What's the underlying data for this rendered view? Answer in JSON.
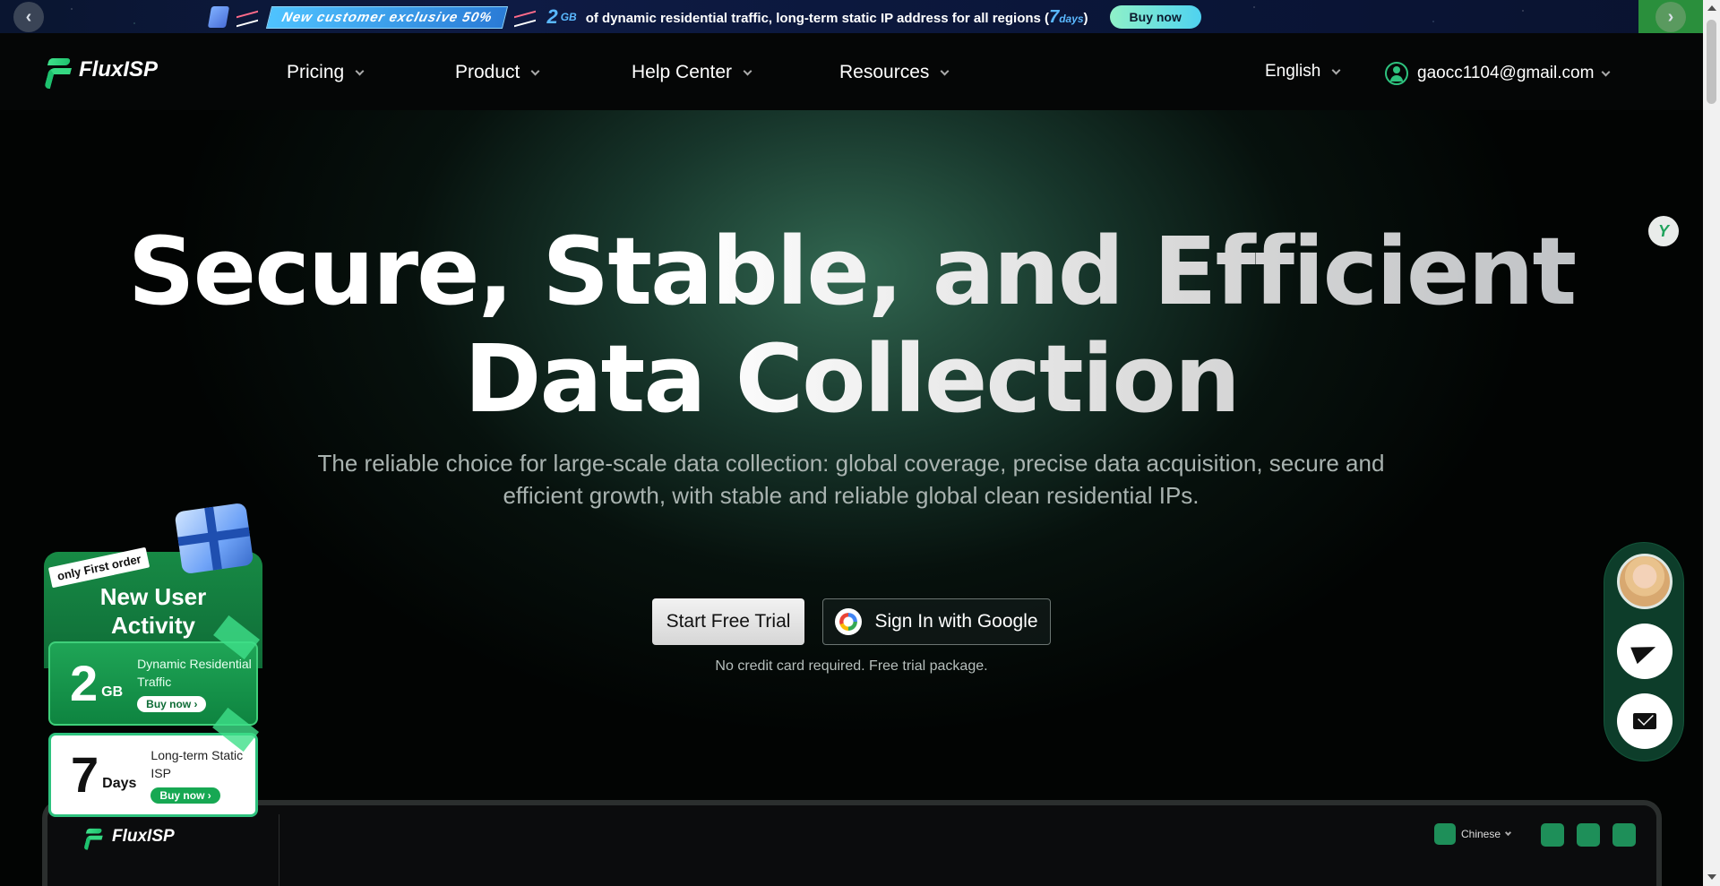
{
  "promo": {
    "badge": "New customer exclusive 50%",
    "amount": "2",
    "unit": "GB",
    "text_before": "of dynamic residential traffic, long-term static IP address for all regions (",
    "days_num": "7",
    "days_unit": "days",
    "text_after": ")",
    "buy_label": "Buy now",
    "prev": "‹",
    "next": "›"
  },
  "nav": {
    "logo": "FluxISP",
    "items": [
      {
        "label": "Pricing"
      },
      {
        "label": "Product"
      },
      {
        "label": "Help Center"
      },
      {
        "label": "Resources"
      }
    ],
    "language": "English",
    "user_email": "gaocc1104@gmail.com"
  },
  "hero": {
    "title_line1": "Secure, Stable, and Efficient",
    "title_line2": "Data Collection",
    "subtitle": "The reliable choice for large-scale data collection: global coverage, precise data acquisition, secure and efficient growth, with stable and reliable global clean residential IPs.",
    "trial_button": "Start Free Trial",
    "google_button": "Sign In with Google",
    "note": "No credit card required. Free trial package."
  },
  "new_user": {
    "badge": "only First order",
    "title_line1": "New User",
    "title_line2": "Activity",
    "card1": {
      "big": "2",
      "small": "GB",
      "label": "Dynamic Residential Traffic",
      "buy": "Buy now ›"
    },
    "card2": {
      "big": "7",
      "small": "Days",
      "label": "Long-term Static ISP",
      "buy": "Buy now ›"
    }
  },
  "device": {
    "logo": "FluxISP",
    "language": "Chinese"
  },
  "float_badge": "Y"
}
